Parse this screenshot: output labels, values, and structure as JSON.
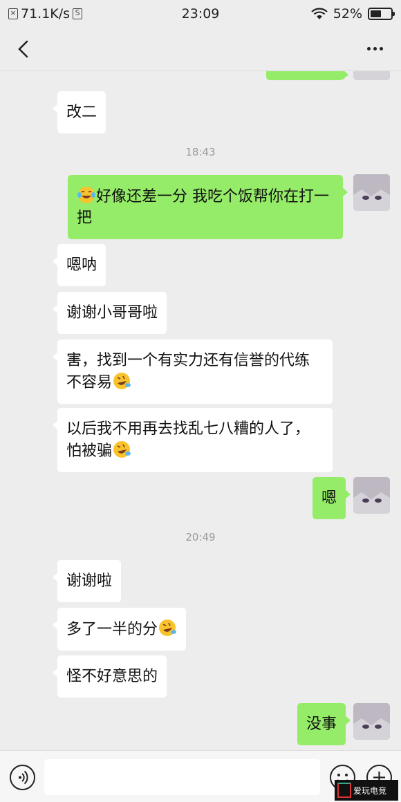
{
  "status_bar": {
    "net_speed": "71.1K/s",
    "time": "23:09",
    "battery": "52%",
    "battery_level": 0.52
  },
  "nav": {
    "back_icon": "chevron-left-icon",
    "more_icon": "more-dots-icon"
  },
  "messages": [
    {
      "side": "out",
      "text": "",
      "partial": true
    },
    {
      "side": "in",
      "text": "改二"
    },
    {
      "type": "time",
      "text": "18:43"
    },
    {
      "side": "out",
      "emoji_prefix": "tears-of-joy",
      "text": "好像还差一分  我吃个饭帮你在打一把"
    },
    {
      "side": "in",
      "text": "嗯呐"
    },
    {
      "side": "in",
      "text": "谢谢小哥哥啦"
    },
    {
      "side": "in",
      "text": "害，找到一个有实力还有信誉的代练不容易",
      "emoji_suffix": "rolling-laugh"
    },
    {
      "side": "in",
      "text": "以后我不用再去找乱七八糟的人了，怕被骗",
      "emoji_suffix": "rolling-laugh"
    },
    {
      "side": "out",
      "text": "嗯"
    },
    {
      "type": "time",
      "text": "20:49"
    },
    {
      "side": "in",
      "text": "谢谢啦"
    },
    {
      "side": "in",
      "text": "多了一半的分",
      "emoji_suffix": "rolling-laugh"
    },
    {
      "side": "in",
      "text": "怪不好意思的"
    },
    {
      "side": "out",
      "text": "没事"
    }
  ],
  "input_bar": {
    "voice_icon": "voice-icon",
    "emoji_icon": "emoji-icon",
    "plus_icon": "plus-icon",
    "input_value": ""
  },
  "watermark": {
    "text": "爱玩电竞"
  }
}
